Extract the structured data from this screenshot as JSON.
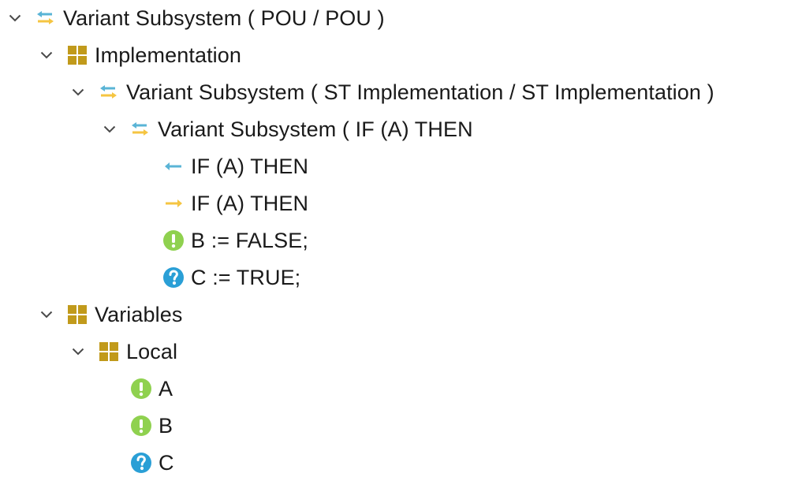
{
  "tree": {
    "root": {
      "label": "Variant Subsystem ( POU / POU )",
      "icon": "variant-subsystem-icon",
      "expanded": true
    },
    "implementation": {
      "label": "Implementation",
      "icon": "folder-grid-icon",
      "expanded": true
    },
    "st_variant": {
      "label": "Variant Subsystem ( ST Implementation / ST Implementation )",
      "icon": "variant-subsystem-icon",
      "expanded": true
    },
    "if_variant": {
      "label": "Variant Subsystem ( IF (A) THEN",
      "icon": "variant-subsystem-icon",
      "expanded": true
    },
    "if_in": {
      "label": "IF (A) THEN",
      "icon": "input-arrow-icon"
    },
    "if_out": {
      "label": "IF (A) THEN",
      "icon": "output-arrow-icon"
    },
    "stmt_b": {
      "label": "B := FALSE;",
      "icon": "exclamation-icon"
    },
    "stmt_c": {
      "label": "C := TRUE;",
      "icon": "question-icon"
    },
    "variables": {
      "label": "Variables",
      "icon": "folder-grid-icon",
      "expanded": true
    },
    "local": {
      "label": "Local",
      "icon": "folder-grid-icon",
      "expanded": true
    },
    "var_a": {
      "label": "A",
      "icon": "exclamation-icon"
    },
    "var_b": {
      "label": "B",
      "icon": "exclamation-icon"
    },
    "var_c": {
      "label": "C",
      "icon": "question-icon"
    }
  },
  "colors": {
    "text": "#1a1a1a",
    "chevron": "#4a4a4a",
    "folder": "#c19a1b",
    "arrow_blue": "#5ab4d6",
    "arrow_yellow": "#f5c542",
    "status_green": "#8fd14f",
    "status_blue": "#2a9fd6"
  }
}
